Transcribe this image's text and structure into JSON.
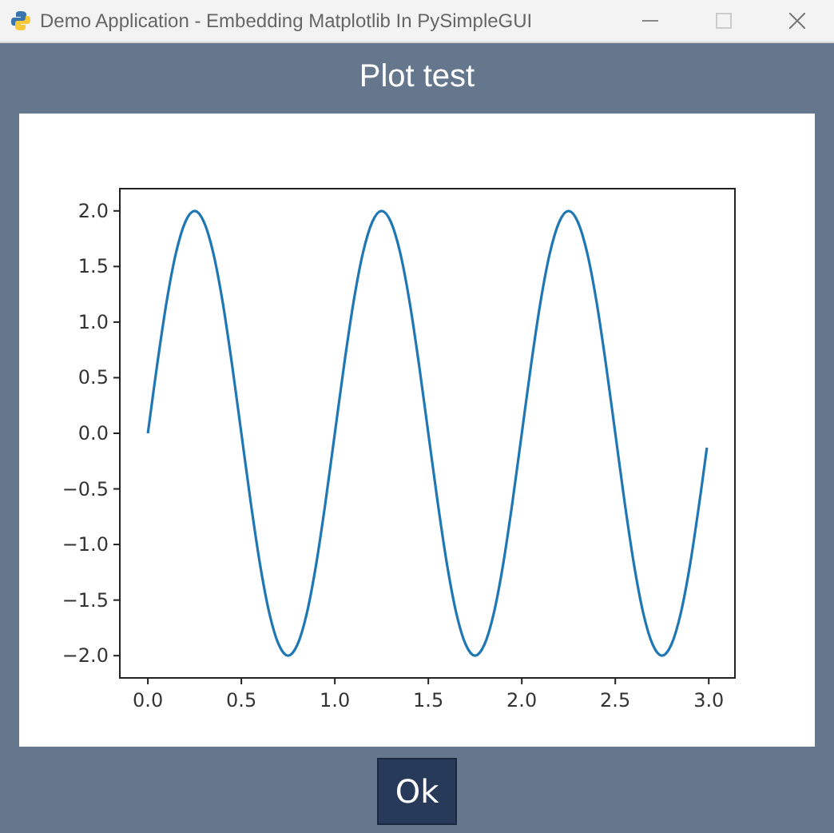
{
  "window": {
    "title": "Demo Application - Embedding Matplotlib In PySimpleGUI"
  },
  "heading": "Plot test",
  "plot": {
    "chart_data": {
      "type": "line",
      "xlim": [
        -0.15,
        3.14
      ],
      "ylim": [
        -2.2,
        2.2
      ],
      "xticks": [
        {
          "value": 0,
          "label": "0.0"
        },
        {
          "value": 0.5,
          "label": "0.5"
        },
        {
          "value": 1,
          "label": "1.0"
        },
        {
          "value": 1.5,
          "label": "1.5"
        },
        {
          "value": 2,
          "label": "2.0"
        },
        {
          "value": 2.5,
          "label": "2.5"
        },
        {
          "value": 3,
          "label": "3.0"
        }
      ],
      "yticks": [
        {
          "value": 2,
          "label": "2.0"
        },
        {
          "value": 1.5,
          "label": "1.5"
        },
        {
          "value": 1,
          "label": "1.0"
        },
        {
          "value": 0.5,
          "label": "0.5"
        },
        {
          "value": 0,
          "label": "0.0"
        },
        {
          "value": -0.5,
          "label": "−0.5"
        },
        {
          "value": -1,
          "label": "−1.0"
        },
        {
          "value": -1.5,
          "label": "−1.5"
        },
        {
          "value": -2,
          "label": "−2.0"
        }
      ],
      "x": [
        0,
        0.05,
        0.1,
        0.15,
        0.2,
        0.25,
        0.3,
        0.35,
        0.4,
        0.45,
        0.5,
        0.55,
        0.6,
        0.65,
        0.7,
        0.75,
        0.8,
        0.85,
        0.9,
        0.95,
        1,
        1.05,
        1.1,
        1.15,
        1.2,
        1.25,
        1.3,
        1.35,
        1.4,
        1.45,
        1.5,
        1.55,
        1.6,
        1.65,
        1.7,
        1.75,
        1.8,
        1.85,
        1.9,
        1.95,
        2,
        2.05,
        2.1,
        2.15,
        2.2,
        2.25,
        2.3,
        2.35,
        2.4,
        2.45,
        2.5,
        2.55,
        2.6,
        2.65,
        2.7,
        2.75,
        2.8,
        2.85,
        2.9,
        2.95,
        2.99
      ],
      "series": [
        {
          "color": "#1f77b4",
          "values": [
            0,
            0.62,
            1.18,
            1.62,
            1.9,
            2,
            1.9,
            1.62,
            1.18,
            0.62,
            0,
            -0.62,
            -1.18,
            -1.62,
            -1.9,
            -2,
            -1.9,
            -1.62,
            -1.18,
            -0.62,
            0,
            0.62,
            1.18,
            1.62,
            1.9,
            2,
            1.9,
            1.62,
            1.18,
            0.62,
            0,
            -0.62,
            -1.18,
            -1.62,
            -1.9,
            -2,
            -1.9,
            -1.62,
            -1.18,
            -0.62,
            0,
            0.62,
            1.18,
            1.62,
            1.9,
            2,
            1.9,
            1.62,
            1.18,
            0.62,
            0,
            -0.62,
            -1.18,
            -1.62,
            -1.9,
            -2,
            -1.9,
            -1.62,
            -1.18,
            -0.62,
            -0.13
          ]
        }
      ]
    }
  },
  "buttons": [
    "Ok"
  ]
}
